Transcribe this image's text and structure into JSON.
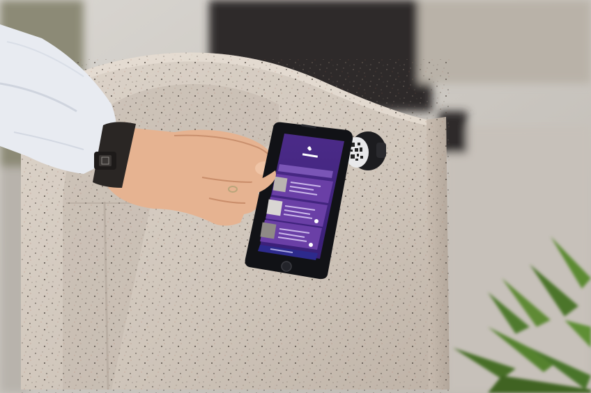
{
  "scene": {
    "description_free": true,
    "colors": {
      "stone_base": "#c9c0b6",
      "stone_light": "#ddd6cd",
      "stone_shadow": "#a89e94",
      "background_blur_dark": "#2f2c2a",
      "background_blur_light": "#c8c3bd",
      "plant_green": "#4f7a2e",
      "sleeve": "#e9ecf2",
      "watch_band": "#2a2624",
      "skin": "#e7b492",
      "phone_body": "#111216",
      "screen_purple_top": "#4a2b86",
      "screen_purple_bottom": "#3b1f78",
      "card_purple": "#6a3fa6",
      "screen_footer_blue": "#2d2a8c",
      "tag_dark": "#1c1c1f",
      "tag_face": "#e8e8ea"
    },
    "icons": [
      "qr-code-icon",
      "app-logo-icon",
      "chevron-right-icon"
    ]
  }
}
